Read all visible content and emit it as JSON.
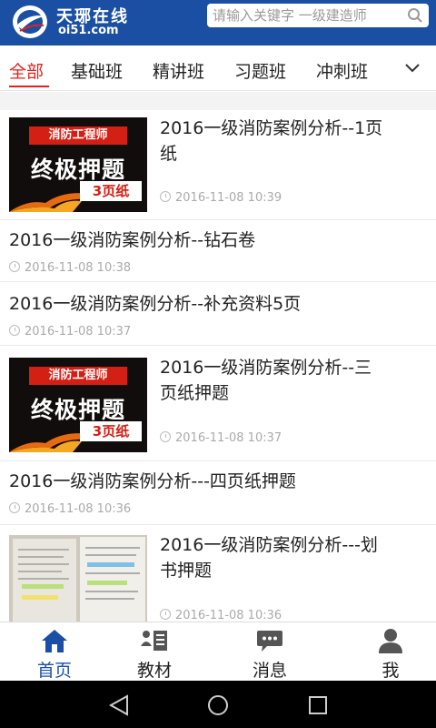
{
  "header": {
    "logo_cn": "天琊在线",
    "logo_en": "oi51.com",
    "search_placeholder": "请输入关键字 一级建造师"
  },
  "tabs": [
    {
      "label": "全部",
      "active": true
    },
    {
      "label": "基础班",
      "active": false
    },
    {
      "label": "精讲班",
      "active": false
    },
    {
      "label": "习题班",
      "active": false
    },
    {
      "label": "冲刺班",
      "active": false
    }
  ],
  "thumb_promo": {
    "line1": "消防工程师",
    "line2": "终极押题",
    "line3": "3页纸"
  },
  "articles": [
    {
      "title_line1": "2016一级消防案例分析--1页",
      "title_line2": "纸",
      "time": "2016-11-08 10:39",
      "thumb": "promo"
    },
    {
      "title_line1": "2016一级消防案例分析--钻石卷",
      "time": "2016-11-08 10:38",
      "thumb": "none"
    },
    {
      "title_line1": "2016一级消防案例分析--补充资料5页",
      "time": "2016-11-08 10:37",
      "thumb": "none"
    },
    {
      "title_line1": "2016一级消防案例分析--三",
      "title_line2": "页纸押题",
      "time": "2016-11-08 10:37",
      "thumb": "promo"
    },
    {
      "title_line1": "2016一级消防案例分析---四页纸押题",
      "time": "2016-11-08 10:36",
      "thumb": "none"
    },
    {
      "title_line1": "2016一级消防案例分析---划",
      "title_line2": "书押题",
      "time": "2016-11-08 10:36",
      "thumb": "photo"
    }
  ],
  "bottom_nav": [
    {
      "label": "首页",
      "icon": "home-icon",
      "active": true
    },
    {
      "label": "教材",
      "icon": "book-list-icon",
      "active": false
    },
    {
      "label": "消息",
      "icon": "message-icon",
      "active": false
    },
    {
      "label": "我",
      "icon": "user-icon",
      "active": false
    }
  ],
  "colors": {
    "brand": "#1a4fa3",
    "accent": "#e0221e",
    "thumb_red": "#e02a1c"
  }
}
